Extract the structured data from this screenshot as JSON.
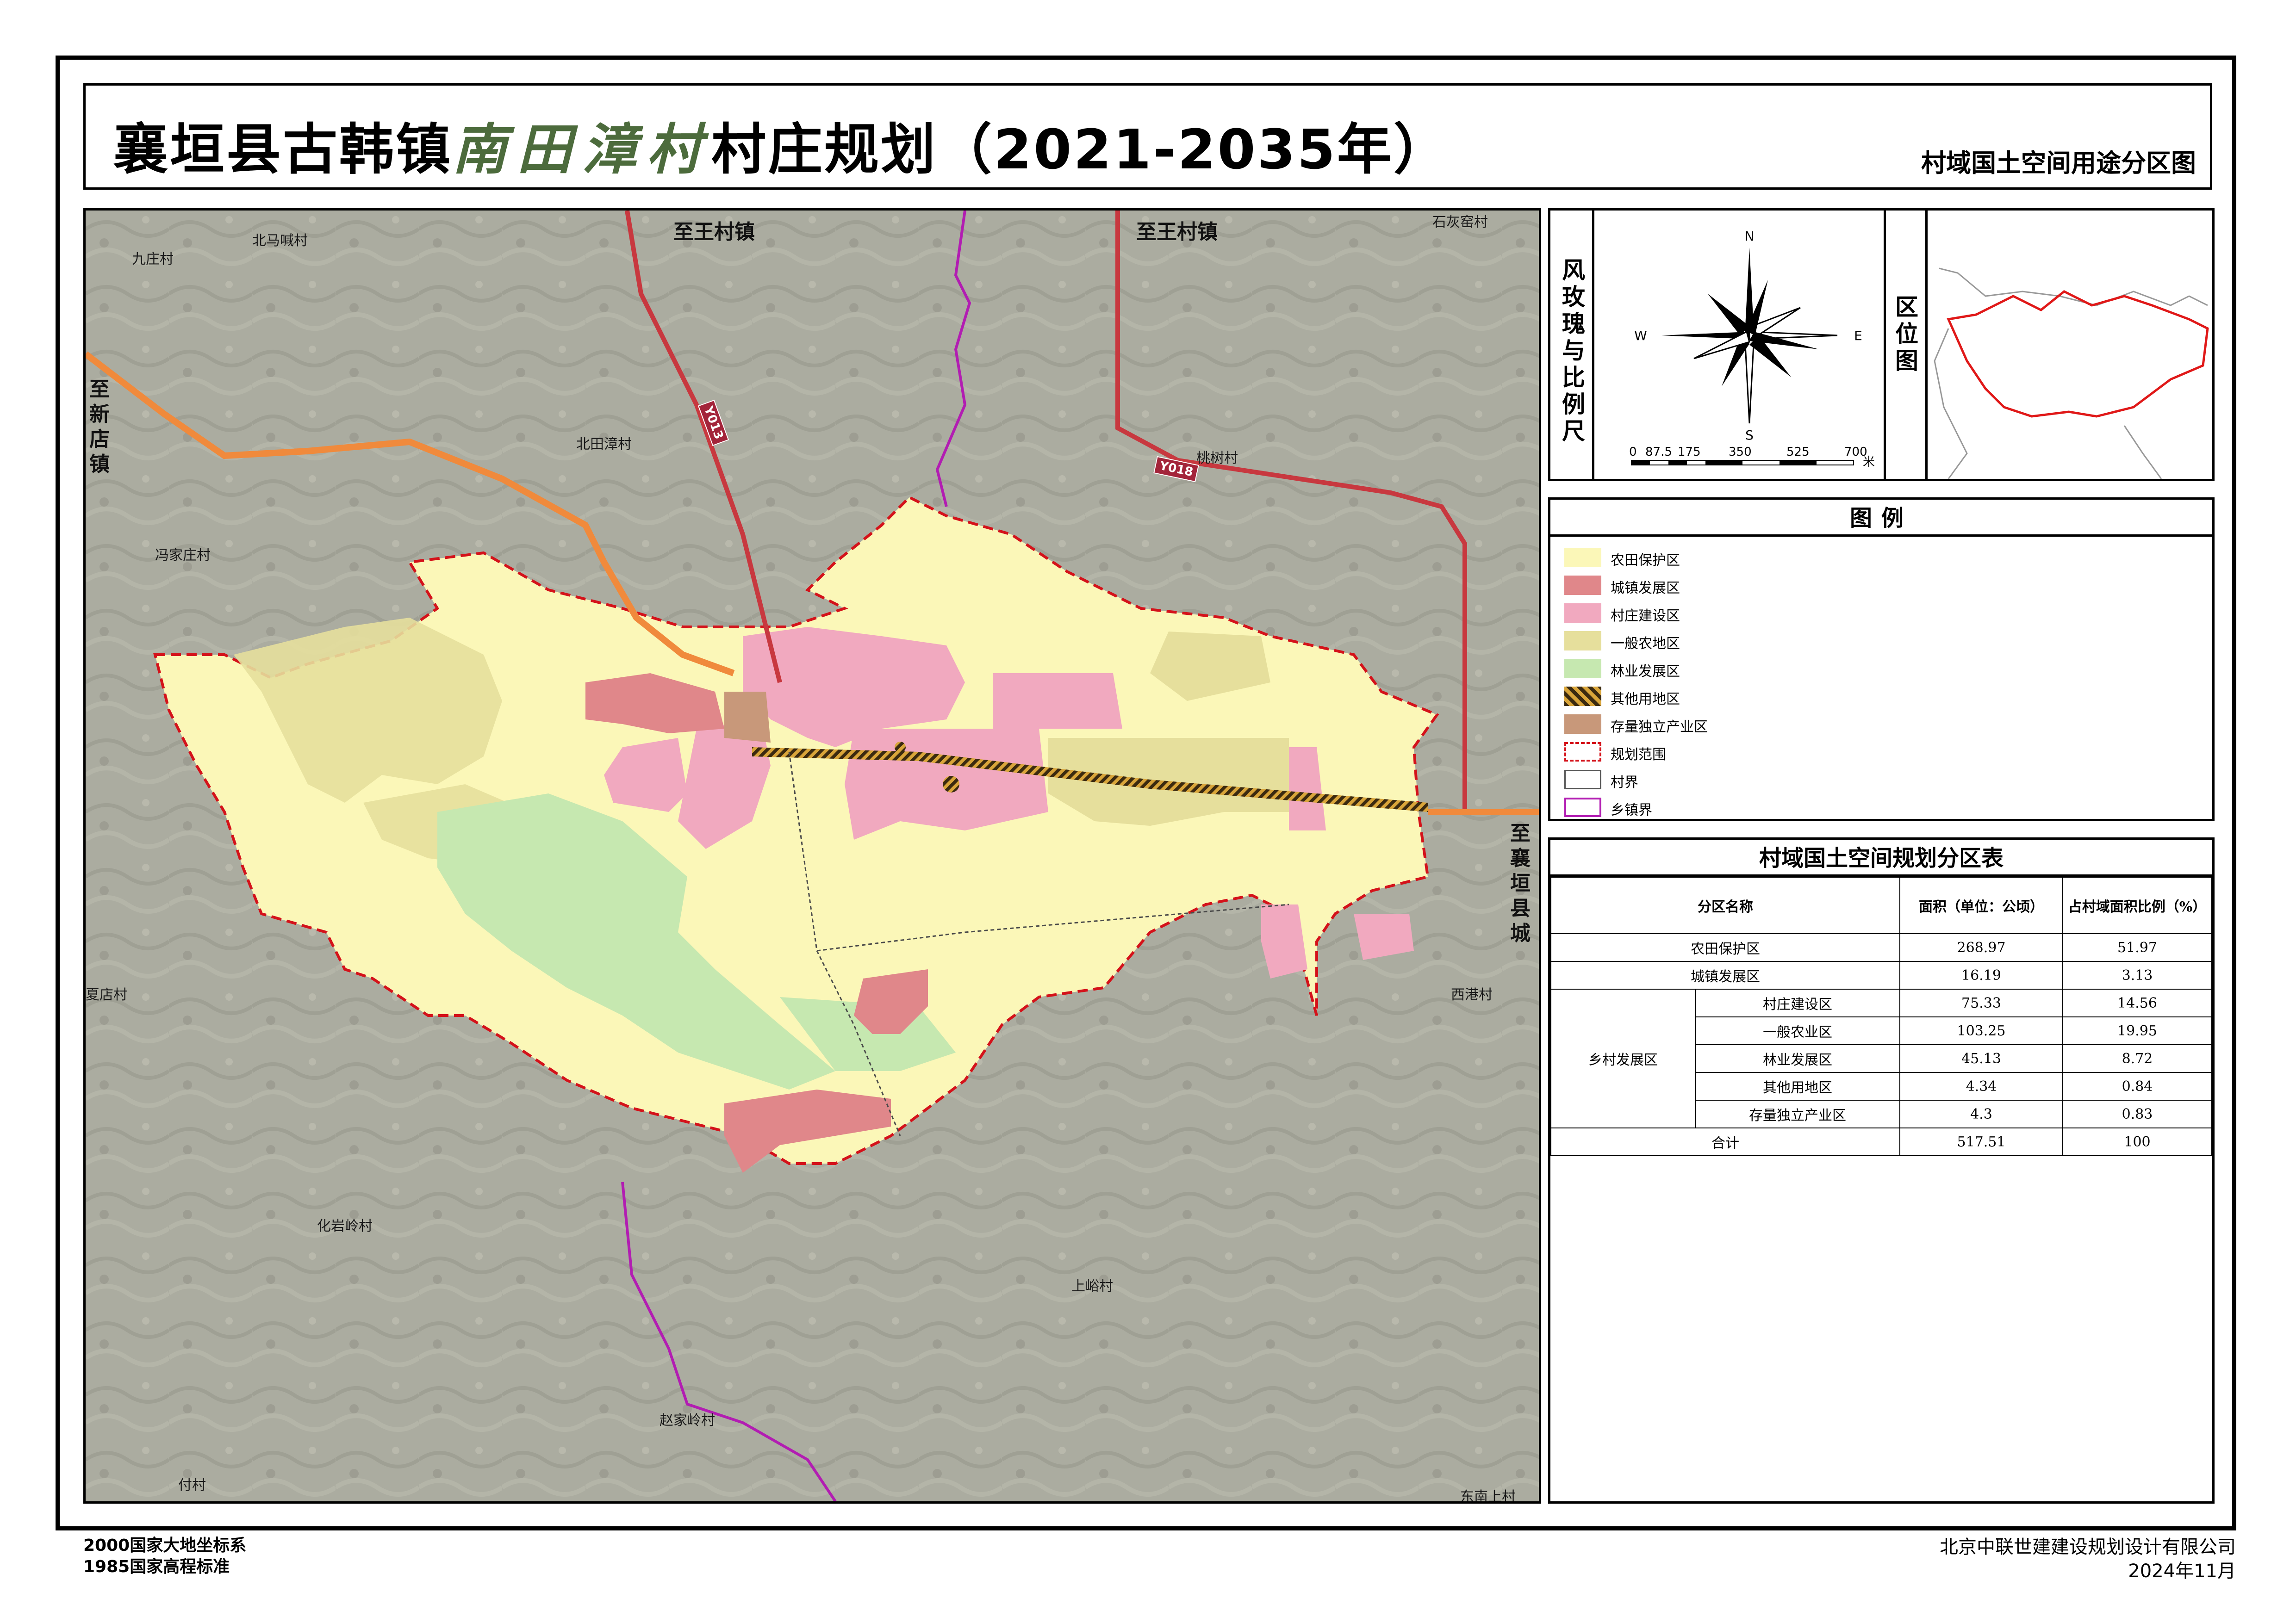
{
  "title": {
    "prefix": "襄垣县古韩镇",
    "village": "南田漳村",
    "suffix": "村庄规划（2021-2035年）",
    "subtitle": "村域国土空间用途分区图"
  },
  "map": {
    "directions": {
      "north_left": "至王村镇",
      "north_right": "至王村镇",
      "west": "至新店镇",
      "east": "至襄垣县城"
    },
    "roads": [
      "Y013",
      "Y018"
    ],
    "places": [
      "北马喊村",
      "九庄村",
      "北田漳村",
      "冯家庄村",
      "桃树村",
      "石灰窑村",
      "夏店村",
      "西港村",
      "化岩岭村",
      "上峪村",
      "赵家岭村",
      "付村",
      "东南上村"
    ],
    "colors": {
      "farmland": "#fbf7b8",
      "town": "#e0878a",
      "village": "#f1a9bf",
      "general_agri": "#e6df9c",
      "forest": "#c6e8b0",
      "industry": "#c8987a",
      "boundary": "#d4121a",
      "township_boundary": "#b21db2",
      "road": "#c8383f",
      "orange_road": "#f08a3c"
    }
  },
  "compass": {
    "label": "风玫瑰与比例尺",
    "n": "N",
    "s": "S",
    "e": "E",
    "w": "W",
    "scale_ticks": [
      "0",
      "87.5",
      "175",
      "350",
      "525",
      "700"
    ],
    "scale_unit": "米",
    "location_label": "区位图"
  },
  "legend": {
    "title": "图例",
    "items": [
      {
        "label": "农田保护区",
        "color": "#fbf7b8",
        "style": "fill"
      },
      {
        "label": "城镇发展区",
        "color": "#e0878a",
        "style": "fill"
      },
      {
        "label": "村庄建设区",
        "color": "#f1a9bf",
        "style": "fill"
      },
      {
        "label": "一般农地区",
        "color": "#e6df9c",
        "style": "fill"
      },
      {
        "label": "林业发展区",
        "color": "#c6e8b0",
        "style": "fill"
      },
      {
        "label": "其他用地区",
        "color": "#6b4a1c",
        "style": "hatch"
      },
      {
        "label": "存量独立产业区",
        "color": "#c8987a",
        "style": "fill"
      },
      {
        "label": "规划范围",
        "color": "#d4121a",
        "style": "dashed"
      },
      {
        "label": "村界",
        "color": "#555555",
        "style": "outline"
      },
      {
        "label": "乡镇界",
        "color": "#b21db2",
        "style": "outline"
      }
    ]
  },
  "table": {
    "title": "村域国土空间规划分区表",
    "headers": [
      "分区名称",
      "面积（单位：公顷）",
      "占村域面积比例（%）"
    ],
    "rows": [
      {
        "group": "",
        "name": "农田保护区",
        "area": "268.97",
        "ratio": "51.97"
      },
      {
        "group": "",
        "name": "城镇发展区",
        "area": "16.19",
        "ratio": "3.13"
      },
      {
        "group": "乡村发展区",
        "name": "村庄建设区",
        "area": "75.33",
        "ratio": "14.56"
      },
      {
        "group": "乡村发展区",
        "name": "一般农业区",
        "area": "103.25",
        "ratio": "19.95"
      },
      {
        "group": "乡村发展区",
        "name": "林业发展区",
        "area": "45.13",
        "ratio": "8.72"
      },
      {
        "group": "乡村发展区",
        "name": "其他用地区",
        "area": "4.34",
        "ratio": "0.84"
      },
      {
        "group": "乡村发展区",
        "name": "存量独立产业区",
        "area": "4.3",
        "ratio": "0.83"
      }
    ],
    "total": {
      "name": "合计",
      "area": "517.51",
      "ratio": "100"
    },
    "group_label": "乡村发展区"
  },
  "footer": {
    "coord_system": "2000国家大地坐标系",
    "elevation_system": "1985国家高程标准",
    "company": "北京中联世建建设规划设计有限公司",
    "date": "2024年11月"
  }
}
